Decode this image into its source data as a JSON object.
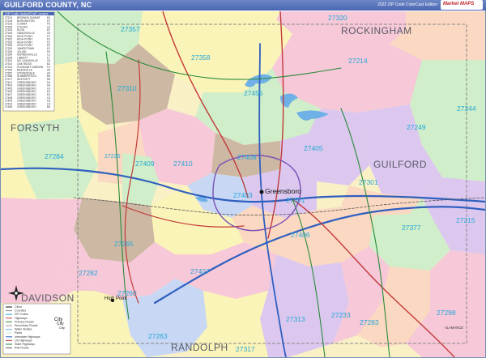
{
  "header": {
    "title": "GUILFORD COUNTY, NC",
    "subtitle": "2022 ZIP Code ColorCast Edition",
    "brand": "Market MAPS"
  },
  "map": {
    "counties": [
      "FORSYTH",
      "GUILFORD",
      "DAVIDSON",
      "RANDOLPH",
      "ROCKINGHAM",
      "ALAMANCE"
    ],
    "cities": [
      "Greensboro",
      "High Point"
    ],
    "zip_labels": [
      "27320",
      "27357",
      "27358",
      "27214",
      "27310",
      "27455",
      "27244",
      "27249",
      "27284",
      "27235",
      "27409",
      "27410",
      "27408",
      "27405",
      "27301",
      "27403",
      "27401",
      "27215",
      "27377",
      "27406",
      "27265",
      "27282",
      "27407",
      "27260",
      "27313",
      "27233",
      "27283",
      "27298",
      "27263",
      "27317"
    ],
    "colors": {
      "pink": "#f6c8d8",
      "peach": "#fbd8c2",
      "yellow": "#fbf4b8",
      "green": "#cfeec9",
      "lavender": "#dcc8ef",
      "tan": "#cdb8a3",
      "blue": "#c8d8f4",
      "label": "#25a7d8"
    }
  },
  "index_table": {
    "title": "ZIP Code Index/Grid Locator",
    "rows": [
      [
        "27214",
        "BROWNS SUMMIT",
        "B1"
      ],
      [
        "27215",
        "BURLINGTON",
        "D7"
      ],
      [
        "27233",
        "CLIMAX",
        "F5"
      ],
      [
        "27235",
        "COLFAX",
        "C2"
      ],
      [
        "27244",
        "ELON",
        "B7"
      ],
      [
        "27249",
        "GIBSONVILLE",
        "C6"
      ],
      [
        "27260",
        "HIGH POINT",
        "F2"
      ],
      [
        "27262",
        "HIGH POINT",
        "E2"
      ],
      [
        "27263",
        "HIGH POINT",
        "F2"
      ],
      [
        "27265",
        "HIGH POINT",
        "E2"
      ],
      [
        "27282",
        "JAMESTOWN",
        "E2"
      ],
      [
        "27283",
        "JULIAN",
        "F5"
      ],
      [
        "27284",
        "KERNERSVILLE",
        "C1"
      ],
      [
        "27298",
        "LIBERTY",
        "F7"
      ],
      [
        "27301",
        "MC LEANSVILLE",
        "C5"
      ],
      [
        "27310",
        "OAK RIDGE",
        "B2"
      ],
      [
        "27313",
        "PLEASANT GARDEN",
        "F4"
      ],
      [
        "27320",
        "REIDSVILLE",
        "A5"
      ],
      [
        "27357",
        "STOKESDALE",
        "A2"
      ],
      [
        "27358",
        "SUMMERFIELD",
        "B3"
      ],
      [
        "27377",
        "WHITSETT",
        "D6"
      ],
      [
        "27401",
        "GREENSBORO",
        "D4"
      ],
      [
        "27403",
        "GREENSBORO",
        "D4"
      ],
      [
        "27405",
        "GREENSBORO",
        "C4"
      ],
      [
        "27406",
        "GREENSBORO",
        "E4"
      ],
      [
        "27407",
        "GREENSBORO",
        "E3"
      ],
      [
        "27408",
        "GREENSBORO",
        "C3"
      ],
      [
        "27409",
        "GREENSBORO",
        "D3"
      ],
      [
        "27410",
        "GREENSBORO",
        "C3"
      ],
      [
        "27455",
        "GREENSBORO",
        "B4"
      ]
    ]
  },
  "legend": {
    "items": [
      "Cities",
      "Counties",
      "ZIP Codes",
      "Highways",
      "Primary Roads",
      "Secondary Roads",
      "Water Bodies",
      "Parks",
      "Interstate Highways",
      "US Highways",
      "State Highways",
      "Rail Roads"
    ],
    "badges": [
      "City",
      "City",
      "City"
    ]
  }
}
